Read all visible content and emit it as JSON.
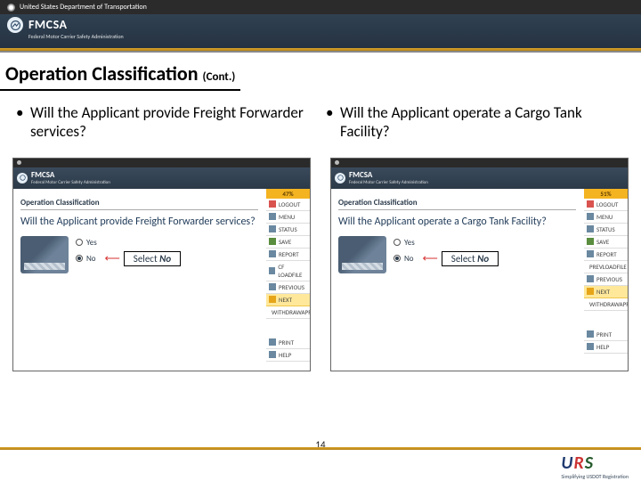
{
  "header": {
    "dept": "United States Department of Transportation",
    "brand": "FMCSA",
    "brand_sub": "Federal Motor Carrier Safety Administration"
  },
  "title_main": "Operation Classification",
  "title_cont": "(Cont.)",
  "bullets": {
    "left": "Will the Applicant provide Freight Forwarder services?",
    "right": "Will the Applicant operate a Cargo Tank Facility?"
  },
  "shot_left": {
    "pct": "47%",
    "brand": "FMCSA",
    "brand_sub": "Federal Motor Carrier Safety Administration",
    "section": "Operation Classification",
    "question": "Will the Applicant provide Freight Forwarder services?",
    "opt_yes": "Yes",
    "opt_no": "No",
    "callout_pre": "Select ",
    "callout_val": "No",
    "menu": {
      "logout": "LOGOUT",
      "menu": "MENU",
      "status": "STATUS",
      "save": "SAVE",
      "report": "REPORT",
      "cf": "CF LOADFILE",
      "prev": "PREVIOUS",
      "next": "NEXT",
      "withdraw": "WITHDRAWAPP",
      "print": "PRINT",
      "help": "HELP"
    }
  },
  "shot_right": {
    "pct": "51%",
    "brand": "FMCSA",
    "brand_sub": "Federal Motor Carrier Safety Administration",
    "section": "Operation Classification",
    "question": "Will the Applicant operate a Cargo Tank Facility?",
    "opt_yes": "Yes",
    "opt_no": "No",
    "callout_pre": "Select ",
    "callout_val": "No",
    "menu": {
      "logout": "LOGOUT",
      "menu": "MENU",
      "status": "STATUS",
      "save": "SAVE",
      "report": "REPORT",
      "prevload": "PREVLOADFILE",
      "prev": "PREVIOUS",
      "next": "NEXT",
      "withdraw": "WITHDRAWAPP",
      "print": "PRINT",
      "help": "HELP"
    }
  },
  "page_number": "14",
  "footer": {
    "urs_tag": "Simplifying USDOT Registration"
  }
}
